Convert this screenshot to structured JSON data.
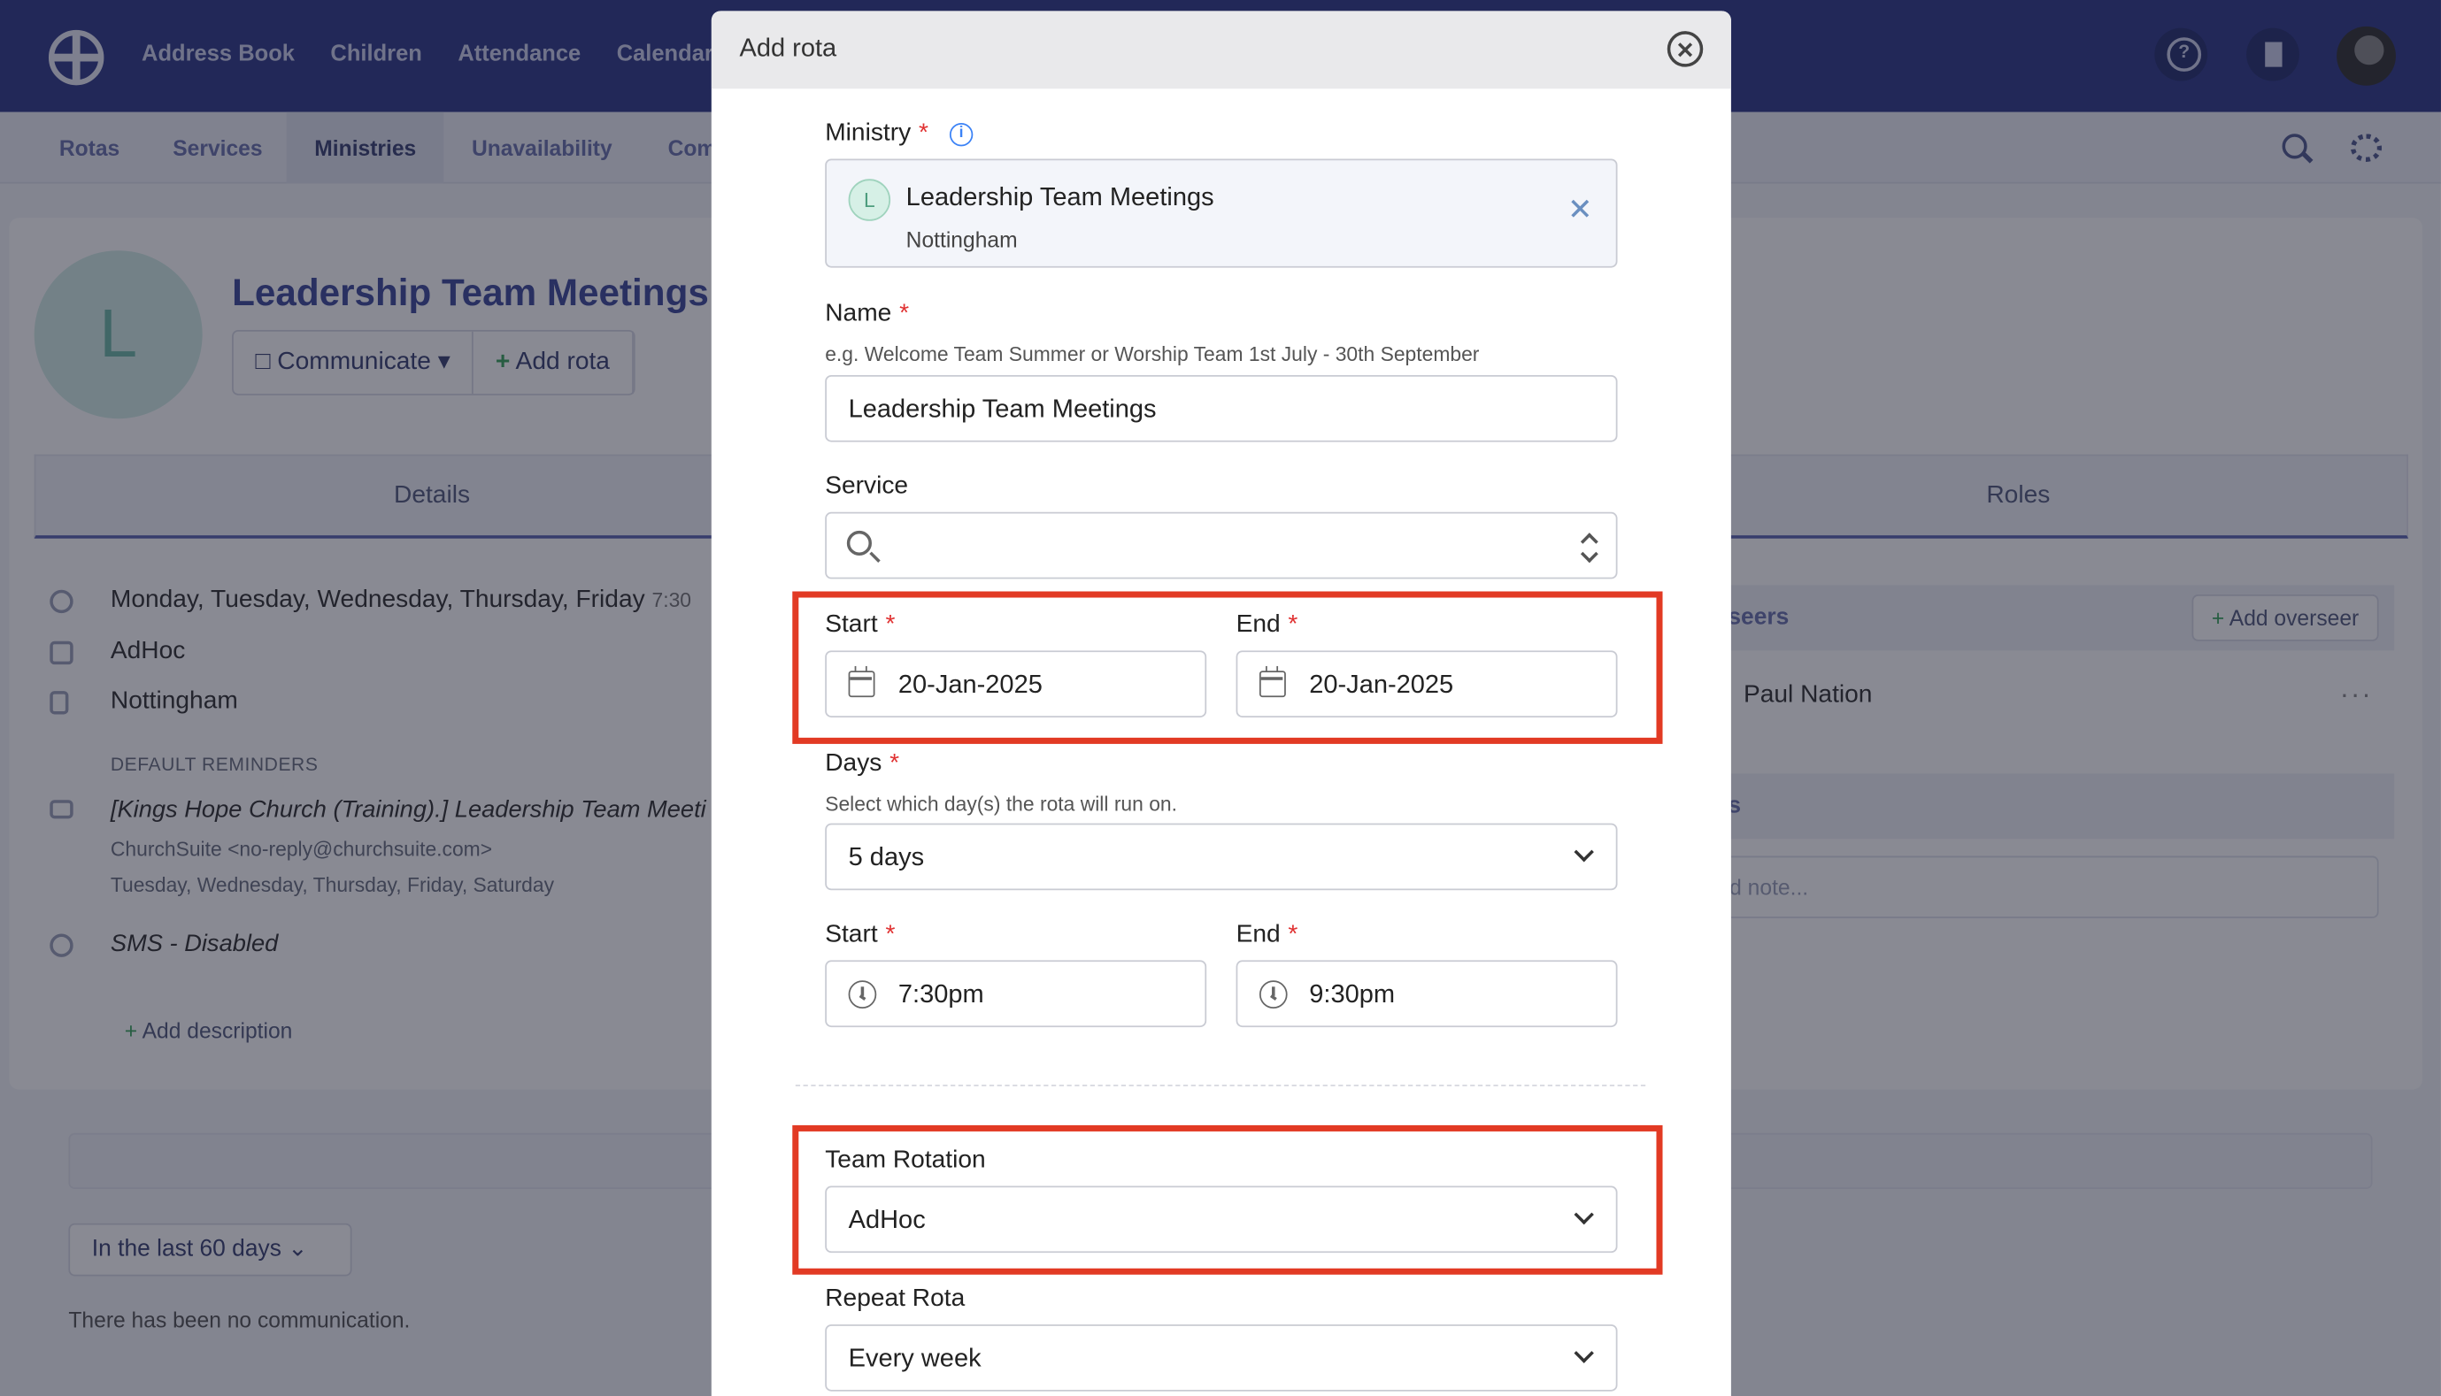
{
  "app": {
    "top_nav": [
      "Address Book",
      "Children",
      "Attendance",
      "Calendar"
    ],
    "sub_nav": [
      "Rotas",
      "Services",
      "Ministries",
      "Unavailability",
      "Com"
    ],
    "sub_nav_active": "Ministries"
  },
  "ministry_page": {
    "avatar_letter": "L",
    "title": "Leadership Team Meetings",
    "buttons": {
      "communicate": "Communicate",
      "add_rota": "Add rota"
    },
    "tabs": {
      "details": "Details",
      "roles": "Roles"
    },
    "details": {
      "days": "Monday, Tuesday, Wednesday, Thursday, Friday",
      "days_time": "7:30",
      "rotation": "AdHoc",
      "location": "Nottingham",
      "reminders_label": "DEFAULT REMINDERS",
      "reminder_subject": "[Kings Hope Church (Training).] Leadership Team Meeti",
      "reminder_from": "ChurchSuite  <no-reply@churchsuite.com>",
      "reminder_days": "Tuesday, Wednesday, Thursday, Friday, Saturday",
      "sms": "SMS - Disabled",
      "add_description": "Add description"
    },
    "overseers": {
      "heading": "seers",
      "add_button": "Add overseer",
      "name": "Paul Nation",
      "more": "···"
    },
    "notes": {
      "heading": "s",
      "placeholder": "d note..."
    },
    "communication": {
      "period": "In the last 60 days",
      "empty": "There has been no communication."
    }
  },
  "modal": {
    "title": "Add rota",
    "ministry": {
      "label": "Ministry",
      "required": "*",
      "avatar_letter": "L",
      "selected_name": "Leadership Team Meetings",
      "selected_location": "Nottingham"
    },
    "name": {
      "label": "Name",
      "required": "*",
      "hint": "e.g. Welcome Team Summer or Worship Team 1st July - 30th September",
      "value": "Leadership Team Meetings"
    },
    "service": {
      "label": "Service",
      "value": ""
    },
    "dates": {
      "start_label": "Start",
      "end_label": "End",
      "required": "*",
      "start_value": "20-Jan-2025",
      "end_value": "20-Jan-2025"
    },
    "days": {
      "label": "Days",
      "required": "*",
      "hint": "Select which day(s) the rota will run on.",
      "value": "5 days"
    },
    "times": {
      "start_label": "Start",
      "end_label": "End",
      "required": "*",
      "start_value": "7:30pm",
      "end_value": "9:30pm"
    },
    "team_rotation": {
      "label": "Team Rotation",
      "value": "AdHoc"
    },
    "repeat_rota": {
      "label": "Repeat Rota",
      "value": "Every week"
    }
  },
  "colors": {
    "topbar": "#303a88",
    "highlight": "#e23a24",
    "required": "#e03131"
  }
}
